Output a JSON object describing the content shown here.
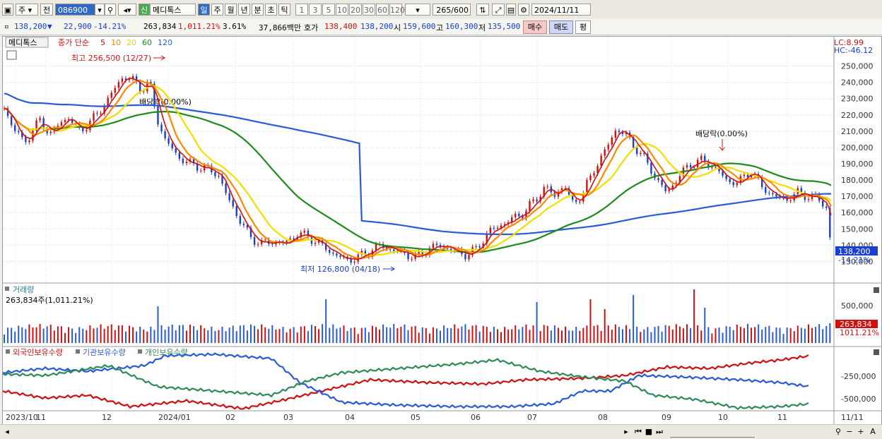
{
  "toolbar": {
    "market": "주",
    "view": "전",
    "code": "086900",
    "badge": "신",
    "name": "메디톡스",
    "periods": [
      "일",
      "주",
      "월",
      "년",
      "분",
      "초",
      "틱"
    ],
    "intervals": [
      "1",
      "3",
      "5",
      "10",
      "20",
      "30",
      "60",
      "120"
    ],
    "count": "265",
    "count_max": "/600",
    "date": "2024/11/11"
  },
  "info": {
    "price": "138,200",
    "arrow": "▼",
    "change": "22,900",
    "change_pct": "-14.21%",
    "volume": "263,834",
    "volume_pct": "1,011.21%",
    "turnover": "3.61%",
    "amount": "37,866백만",
    "quote_label": "호가",
    "ask": "138,400",
    "bid": "138,200",
    "open_label": "시",
    "open": "159,600",
    "high_label": "고",
    "high": "160,300",
    "low_label": "저",
    "low": "135,500",
    "buy_btn": "매수",
    "sell_btn": "매도",
    "eval_btn": "평"
  },
  "price_panel": {
    "name_tag": "메디톡스",
    "ma_label": "종가 단순",
    "ma_periods": [
      {
        "p": "5",
        "color": "#d01010"
      },
      {
        "p": "10",
        "color": "#ff8800"
      },
      {
        "p": "20",
        "color": "#e8d800"
      },
      {
        "p": "60",
        "color": "#1e8a1e"
      },
      {
        "p": "120",
        "color": "#2a5bd7"
      }
    ],
    "lc": "LC:8.99",
    "hc": "HC:-46.12",
    "high_note": "최고 256,500 (12/27)",
    "low_note": "최저 126,800 (04/18)",
    "div_note1": "배당락(0.00%)",
    "div_note2": "배당락(0.00%)",
    "price_tag": "138,200",
    "price_tag_pct": "-14.21%",
    "y_ticks": [
      "250,000",
      "240,000",
      "230,000",
      "220,000",
      "210,000",
      "200,000",
      "190,000",
      "180,000",
      "170,000",
      "160,000",
      "150,000",
      "140,000",
      "130,000"
    ]
  },
  "volume_panel": {
    "title": "거래량",
    "sub": "263,834주(1,011.21%)",
    "y_tick": "500,000",
    "tag": "263,834",
    "tag_pct": "1011.21%"
  },
  "holding_panel": {
    "legend": [
      {
        "label": "외국인보유수량",
        "color": "#d01010"
      },
      {
        "label": "기관보유수량",
        "color": "#2a5bd7"
      },
      {
        "label": "개인보유수량",
        "color": "#2e8b57"
      }
    ],
    "y_ticks": [
      "-250,000",
      "-500,000"
    ]
  },
  "x_labels": [
    "2023/10",
    "11",
    "12",
    "2024/01",
    "02",
    "03",
    "04",
    "05",
    "06",
    "07",
    "08",
    "09",
    "10",
    "11"
  ],
  "x_right": "11/11",
  "chart_data": {
    "type": "candlestick",
    "x": [
      "2023/10",
      "11",
      "12",
      "2024/01",
      "02",
      "03",
      "04",
      "05",
      "06",
      "07",
      "08",
      "09",
      "10",
      "11"
    ],
    "close": [
      212000,
      214000,
      218000,
      243000,
      205000,
      150000,
      142000,
      138000,
      135000,
      152000,
      200000,
      185000,
      177000,
      138200
    ],
    "ma120": [
      241000,
      236000,
      233000,
      231000,
      225000,
      204000,
      184000,
      168000,
      152000,
      149000,
      153000,
      159000,
      163000,
      166000
    ],
    "ma60": [
      238000,
      232000,
      221000,
      217000,
      221000,
      204000,
      171000,
      154000,
      147000,
      148000,
      158000,
      174000,
      185000,
      183000
    ],
    "volume_max_tick": 500000,
    "ylim": [
      125000,
      255000
    ]
  }
}
